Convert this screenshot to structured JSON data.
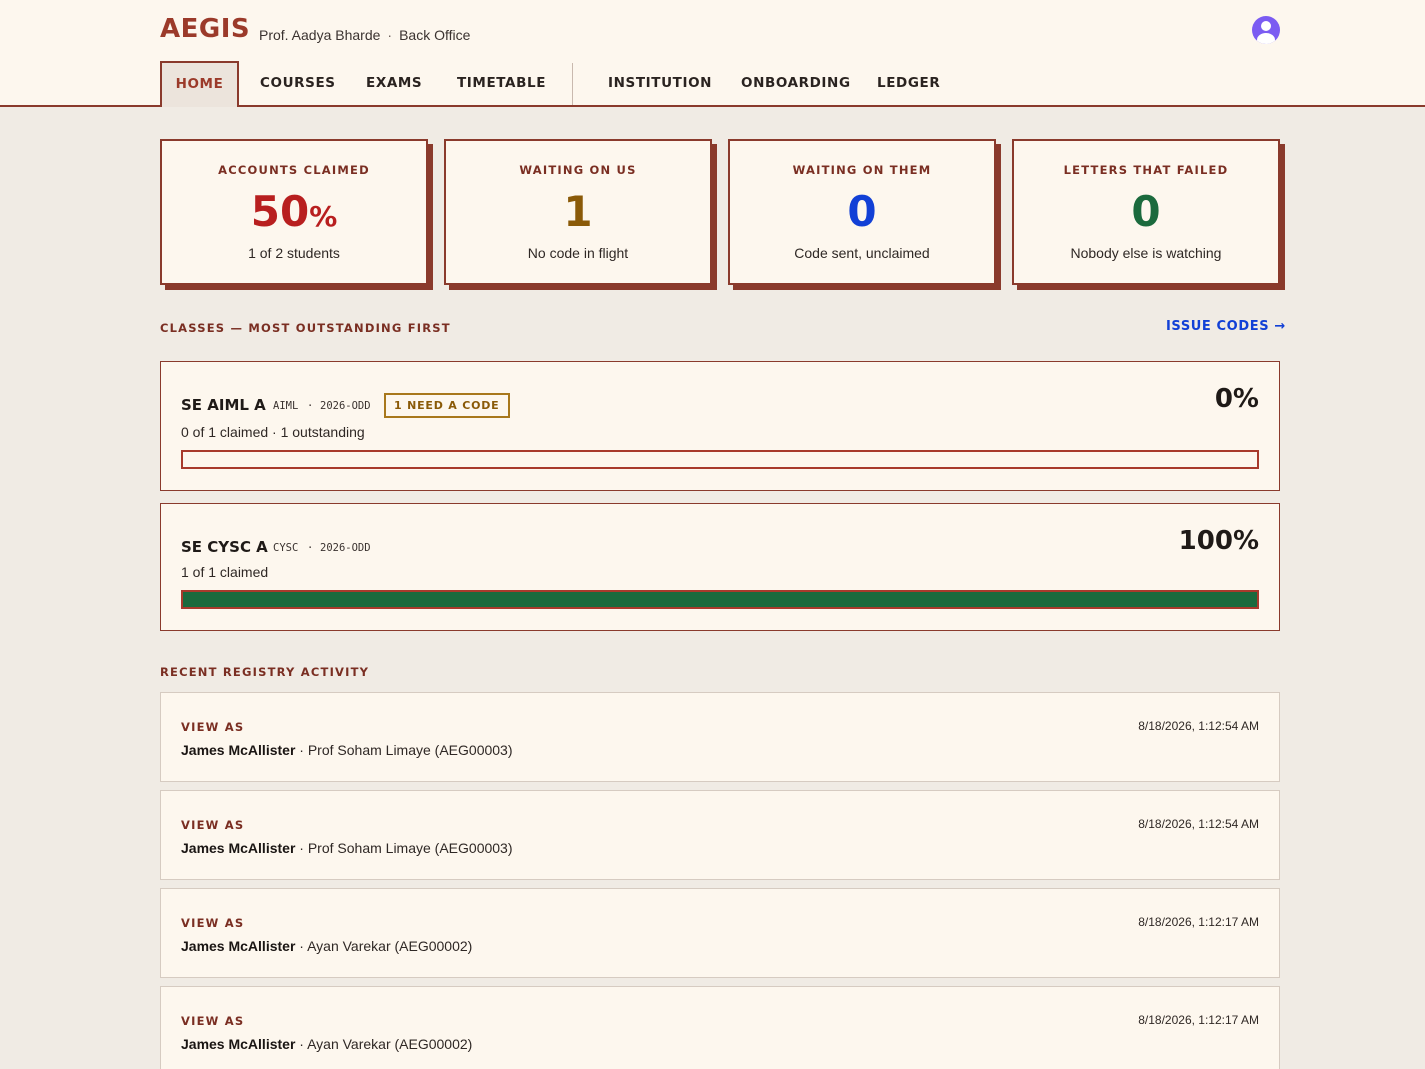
{
  "header": {
    "brand": "AEGIS",
    "user": "Prof. Aadya Bharde",
    "separator": "·",
    "context": "Back Office",
    "avatar_icon": "user-avatar-icon",
    "tabs": [
      {
        "label": "HOME",
        "active": true
      },
      {
        "label": "COURSES"
      },
      {
        "label": "EXAMS"
      },
      {
        "label": "TIMETABLE"
      },
      {
        "label": "INSTITUTION"
      },
      {
        "label": "ONBOARDING"
      },
      {
        "label": "LEDGER"
      }
    ]
  },
  "stats": [
    {
      "label": "ACCOUNTS CLAIMED",
      "value": "50",
      "unit": "%",
      "caption": "1 of 2 students",
      "color": "#b81f1f"
    },
    {
      "label": "WAITING ON US",
      "value": "1",
      "caption": "No code in flight",
      "color": "#8a5a08"
    },
    {
      "label": "WAITING ON THEM",
      "value": "0",
      "caption": "Code sent, unclaimed",
      "color": "#1240d6"
    },
    {
      "label": "LETTERS THAT FAILED",
      "value": "0",
      "caption": "Nobody else is watching",
      "color": "#1b6a3d"
    }
  ],
  "classes_section": {
    "title": "CLASSES — MOST OUTSTANDING FIRST",
    "action": "ISSUE CODES",
    "action_icon": "→"
  },
  "classes": [
    {
      "name": "SE AIML A",
      "dept": "AIML",
      "dot": "·",
      "term": "2026-ODD",
      "badge": "1 NEED A CODE",
      "summary": "0 of 1 claimed · 1 outstanding",
      "percent_label": "0%",
      "progress": 0
    },
    {
      "name": "SE CYSC A",
      "dept": "CYSC",
      "dot": "·",
      "term": "2026-ODD",
      "summary": "1 of 1 claimed",
      "percent_label": "100%",
      "progress": 100
    }
  ],
  "activity_section": {
    "title": "RECENT REGISTRY ACTIVITY"
  },
  "activity": [
    {
      "kind": "VIEW AS",
      "actor": "James McAllister",
      "target": " · Prof Soham Limaye (AEG00003)",
      "timestamp": "8/18/2026, 1:12:54 AM"
    },
    {
      "kind": "VIEW AS",
      "actor": "James McAllister",
      "target": " · Prof Soham Limaye (AEG00003)",
      "timestamp": "8/18/2026, 1:12:54 AM"
    },
    {
      "kind": "VIEW AS",
      "actor": "James McAllister",
      "target": " · Ayan Varekar (AEG00002)",
      "timestamp": "8/18/2026, 1:12:17 AM"
    },
    {
      "kind": "VIEW AS",
      "actor": "James McAllister",
      "target": " · Ayan Varekar (AEG00002)",
      "timestamp": "8/18/2026, 1:12:17 AM"
    }
  ]
}
